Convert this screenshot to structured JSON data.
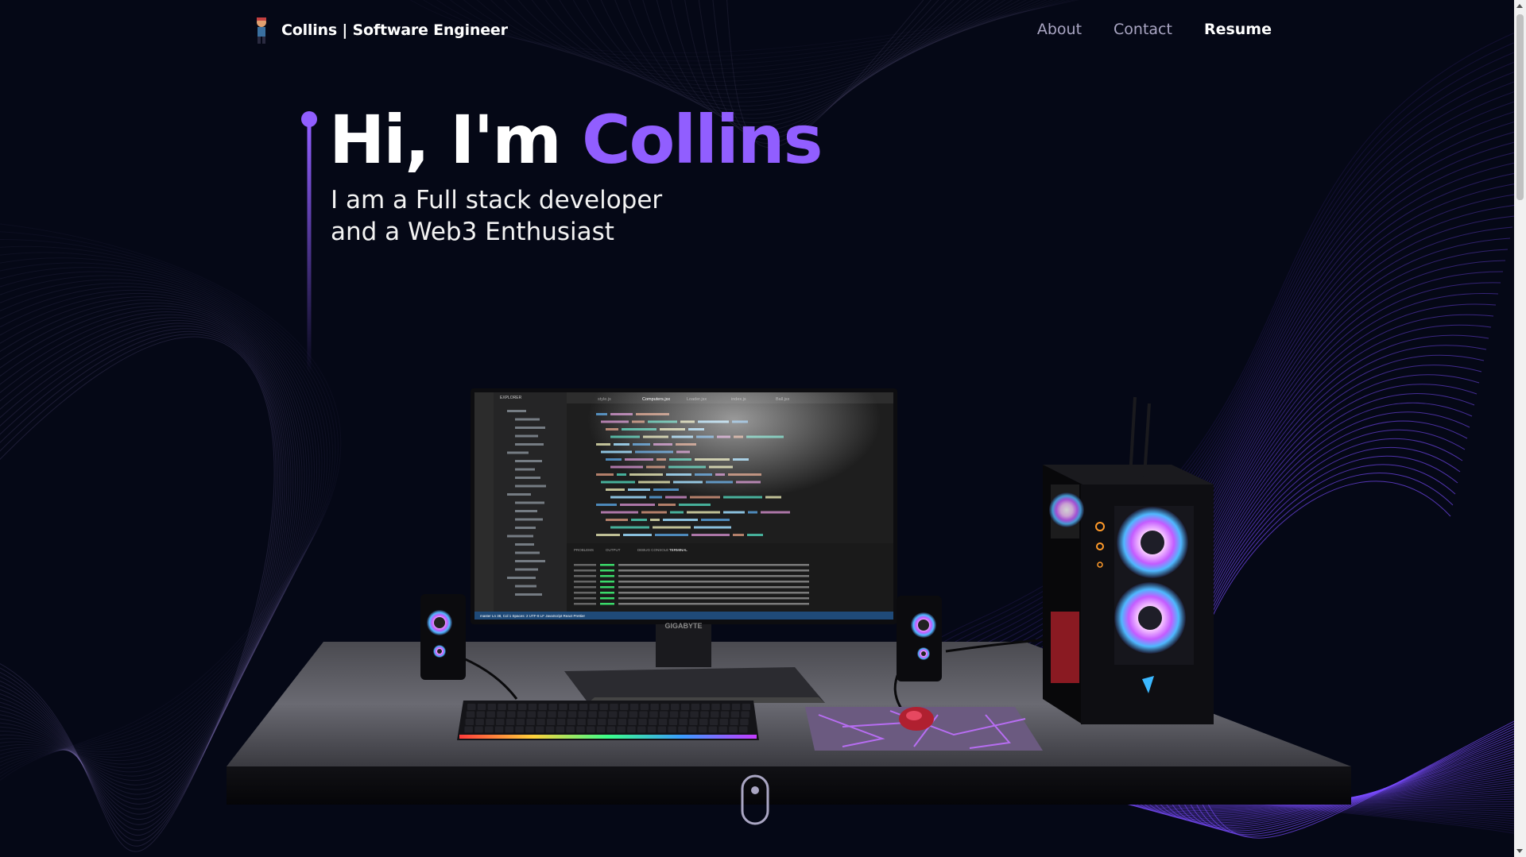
{
  "nav": {
    "brand_name": "Collins",
    "brand_role": " | Software Engineer",
    "links": [
      {
        "label": "About",
        "active": false
      },
      {
        "label": "Contact",
        "active": false
      },
      {
        "label": "Resume",
        "active": true
      }
    ]
  },
  "hero": {
    "title_prefix": "Hi, I'm ",
    "title_name": "Collins",
    "subtitle_line1": "I am a Full stack developer",
    "subtitle_line2": "and a Web3 Enthusiast"
  },
  "scene": {
    "monitor_brand": "GIGABYTE",
    "editor_tabs": [
      "style.js",
      "Computers.jsx",
      "Loader.jsx",
      "index.js",
      "Ball.jsx"
    ],
    "panel_tabs": [
      "PROBLEMS",
      "OUTPUT",
      "DEBUG CONSOLE",
      "TERMINAL"
    ],
    "explorer_title": "EXPLORER",
    "status_bar": "master  Ln 38, Col 1  Spaces: 2  UTF-8  LF  JavaScript React  Prettier"
  },
  "colors": {
    "background": "#050816",
    "accent": "#915eff",
    "text_secondary": "#aaa6c3"
  }
}
